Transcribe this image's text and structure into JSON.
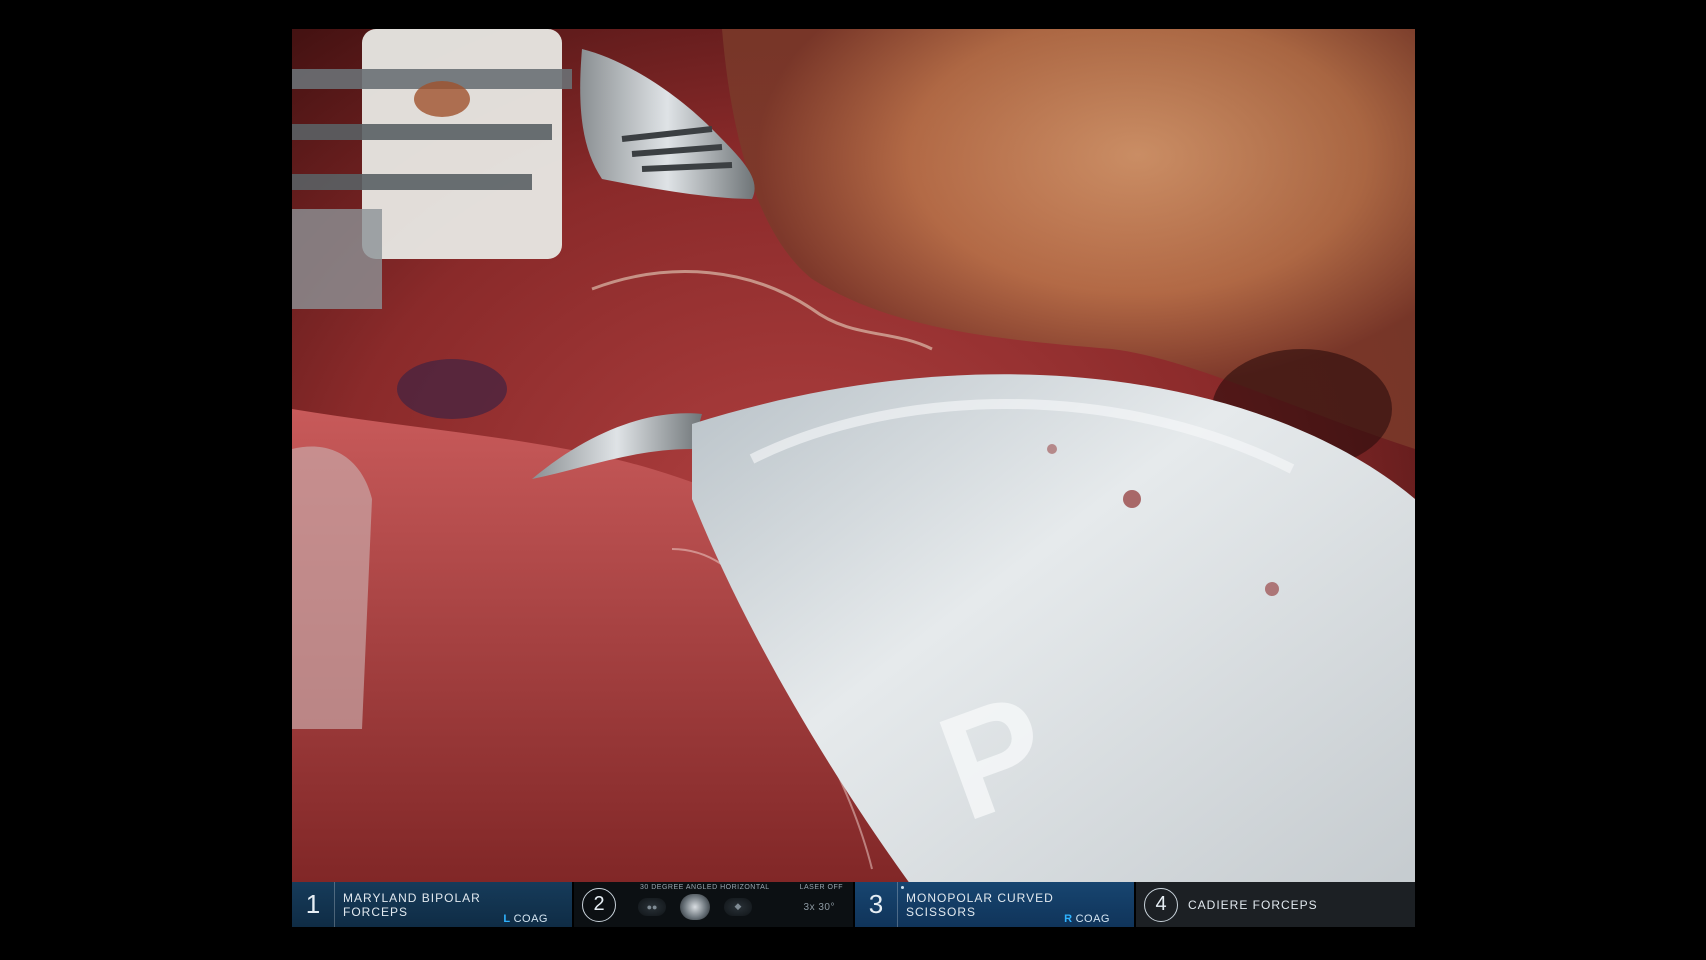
{
  "instruments": [
    {
      "arm": "1",
      "name": "MARYLAND BIPOLAR FORCEPS",
      "energy_letter": "L",
      "energy_mode": "COAG",
      "active_color": "#163b5a"
    },
    {
      "arm": "2",
      "camera_label_left": "30 DEGREE ANGLED HORIZONTAL",
      "camera_label_right": "LASER OFF",
      "camera_angle": "3x 30°"
    },
    {
      "arm": "3",
      "name": "MONOPOLAR CURVED SCISSORS",
      "energy_letter": "R",
      "energy_mode": "COAG",
      "active_color": "#174570"
    },
    {
      "arm": "4",
      "name": "CADIERE FORCEPS"
    }
  ],
  "scene": {
    "instrument_tip_text": "P",
    "colors": {
      "tissue": "#8b2a2a",
      "fat": "#c98e5a",
      "instrument": "#d9dde0"
    }
  }
}
